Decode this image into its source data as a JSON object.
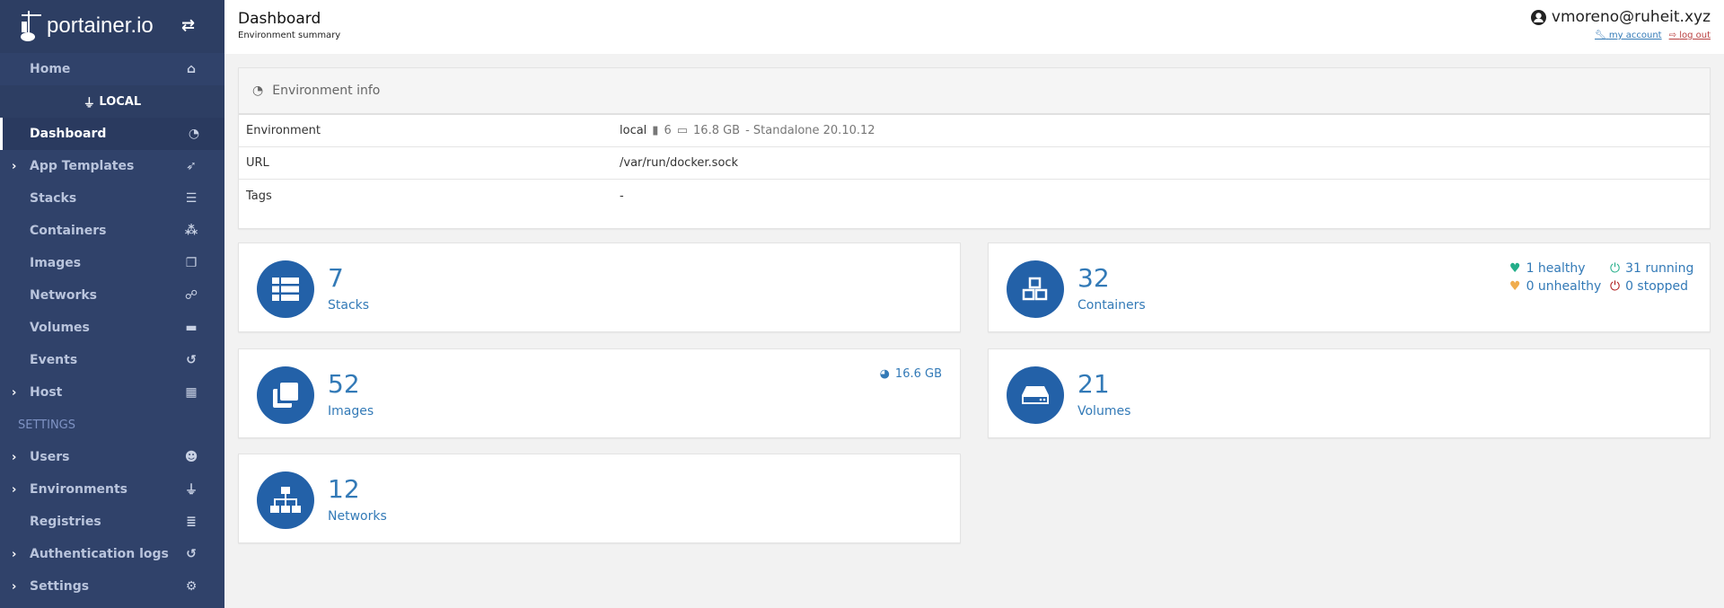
{
  "sidebar": {
    "logo_text": "portainer.io",
    "items": [
      {
        "label": "Home",
        "icon": "home-icon",
        "glyph": "⌂"
      },
      {
        "label": "LOCAL",
        "icon": "plug-icon",
        "glyph": "⏚"
      },
      {
        "label": "Dashboard",
        "icon": "tachometer-icon",
        "glyph": "◔"
      },
      {
        "label": "App Templates",
        "icon": "rocket-icon",
        "glyph": "➶"
      },
      {
        "label": "Stacks",
        "icon": "th-list-icon",
        "glyph": "☰"
      },
      {
        "label": "Containers",
        "icon": "cubes-icon",
        "glyph": "⁂"
      },
      {
        "label": "Images",
        "icon": "clone-icon",
        "glyph": "❐"
      },
      {
        "label": "Networks",
        "icon": "sitemap-icon",
        "glyph": "☍"
      },
      {
        "label": "Volumes",
        "icon": "hdd-icon",
        "glyph": "▬"
      },
      {
        "label": "Events",
        "icon": "history-icon",
        "glyph": "↺"
      },
      {
        "label": "Host",
        "icon": "th-icon",
        "glyph": "▦"
      },
      {
        "label": "SETTINGS"
      },
      {
        "label": "Users",
        "icon": "users-icon",
        "glyph": "☻"
      },
      {
        "label": "Environments",
        "icon": "plug-icon",
        "glyph": "⏚"
      },
      {
        "label": "Registries",
        "icon": "database-icon",
        "glyph": "≣"
      },
      {
        "label": "Authentication logs",
        "icon": "history-icon",
        "glyph": "↺"
      },
      {
        "label": "Settings",
        "icon": "cogs-icon",
        "glyph": "⚙"
      }
    ]
  },
  "header": {
    "title": "Dashboard",
    "subtitle": "Environment summary",
    "user": "vmoreno@ruheit.xyz",
    "my_account": "my account",
    "log_out": "log out"
  },
  "env_info": {
    "title": "Environment info",
    "rows": [
      {
        "key": "Environment",
        "name": "local",
        "cpu": "6",
        "memory": "16.8 GB",
        "details": "- Standalone 20.10.12"
      },
      {
        "key": "URL",
        "value": "/var/run/docker.sock"
      },
      {
        "key": "Tags",
        "value": "-"
      }
    ]
  },
  "cards": {
    "stacks": {
      "count": "7",
      "label": "Stacks"
    },
    "containers": {
      "count": "32",
      "label": "Containers",
      "healthy": "1 healthy",
      "unhealthy": "0 unhealthy",
      "running": "31 running",
      "stopped": "0 stopped"
    },
    "images": {
      "count": "52",
      "label": "Images",
      "size": "16.6 GB"
    },
    "volumes": {
      "count": "21",
      "label": "Volumes"
    },
    "networks": {
      "count": "12",
      "label": "Networks"
    }
  },
  "colors": {
    "sidebar": "#30426a",
    "accent": "#337ab7",
    "icon_bg": "#2361a8",
    "healthy": "#23ae89",
    "unhealthy": "#f0ad4e",
    "stopped": "#ae1717"
  }
}
